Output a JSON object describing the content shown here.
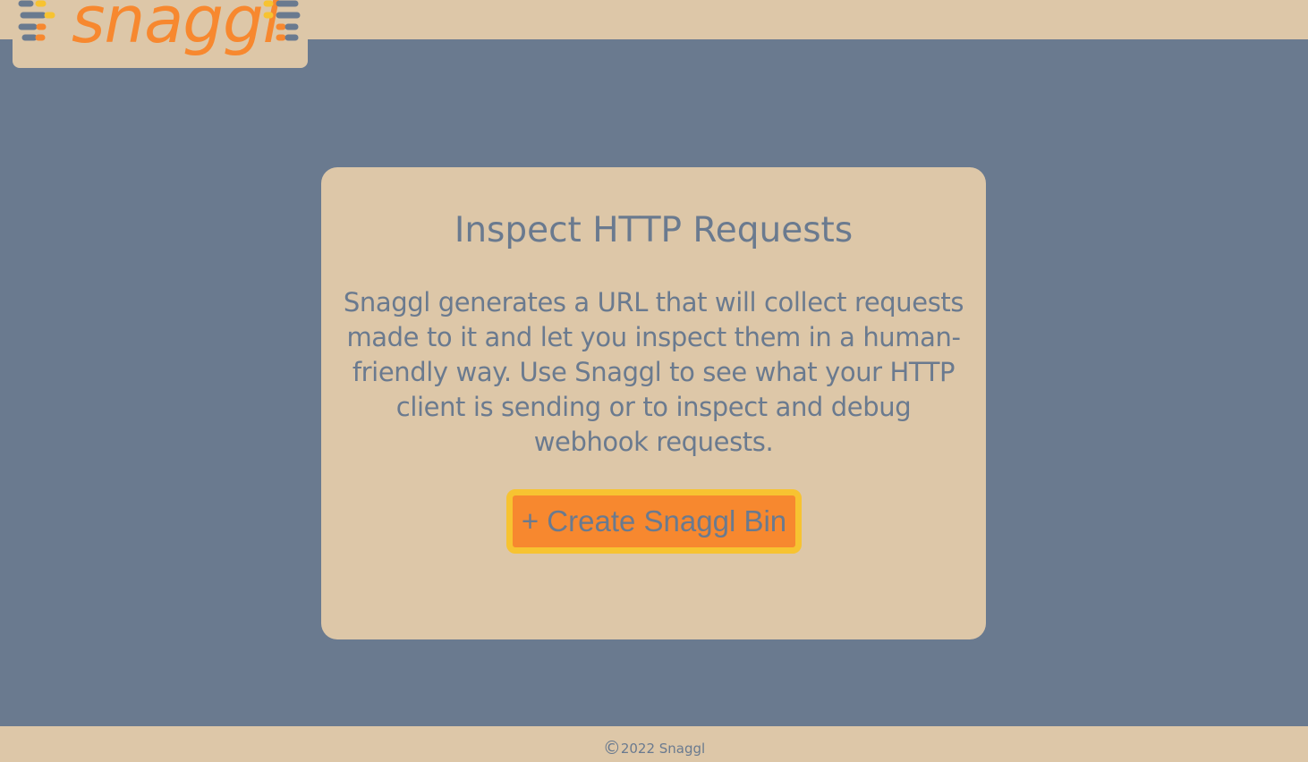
{
  "header": {
    "logo_text": "snaggl",
    "logo_icon": "speed-lines-icon"
  },
  "main": {
    "title": "Inspect HTTP Requests",
    "description": "Snaggl generates a URL that will collect requests made to it and let you inspect them in a human-friendly way. Use Snaggl to see what your HTTP client is sending or to inspect and debug webhook requests.",
    "create_button_label": "+ Create Snaggl Bin"
  },
  "footer": {
    "copyright_symbol": "©",
    "copyright_text": "2022 Snaggl"
  },
  "colors": {
    "background": "#6a7a8f",
    "panel": "#ddc7a8",
    "accent": "#f7882f",
    "button_border": "#f7c331"
  }
}
